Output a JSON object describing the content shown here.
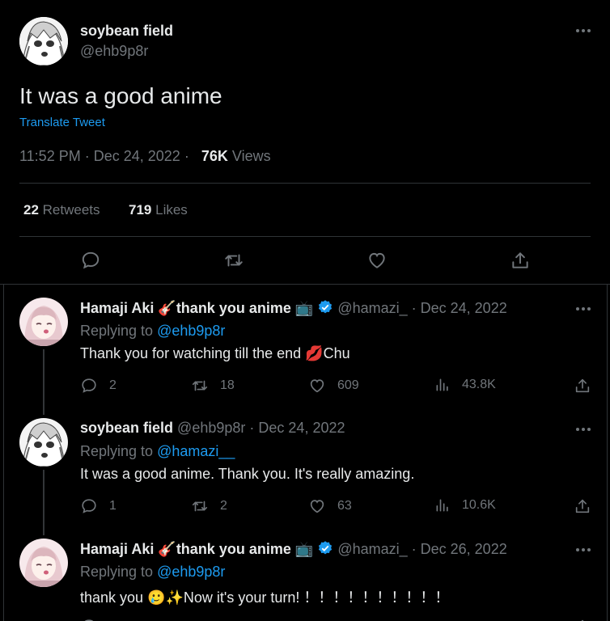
{
  "main_tweet": {
    "author_name": "soybean field",
    "author_handle": "@ehb9p8r",
    "text": "It was a good anime",
    "translate_label": "Translate Tweet",
    "time": "11:52 PM",
    "date": "Dec 24, 2022",
    "views_count": "76K",
    "views_label": "Views",
    "retweets_count": "22",
    "retweets_label": "Retweets",
    "likes_count": "719",
    "likes_label": "Likes"
  },
  "replies": [
    {
      "name": "Hamaji Aki",
      "name_suffix": "thank you anime",
      "verified": true,
      "handle": "@hamazi_",
      "date": "Dec 24, 2022",
      "replying_label": "Replying to",
      "replying_to": "@ehb9p8r",
      "text": "Thank you for watching till the end",
      "text_tail": "Chu",
      "emoji": [
        "lips"
      ],
      "replies": "2",
      "retweets": "18",
      "likes": "609",
      "views": "43.8K"
    },
    {
      "name": "soybean field",
      "verified": false,
      "handle": "@ehb9p8r",
      "date": "Dec 24, 2022",
      "replying_label": "Replying to",
      "replying_to": "@hamazi__",
      "text": "It was a good anime. Thank you. It's really amazing.",
      "replies": "1",
      "retweets": "2",
      "likes": "63",
      "views": "10.6K"
    },
    {
      "name": "Hamaji Aki",
      "name_suffix": "thank you anime",
      "verified": true,
      "handle": "@hamazi_",
      "date": "Dec 26, 2022",
      "replying_label": "Replying to",
      "replying_to": "@ehb9p8r",
      "text": "thank you",
      "text_tail": "Now it's your turn! ！！！！！！！！！！",
      "emoji": [
        "smiling-face-with-tear",
        "sparkles"
      ]
    }
  ],
  "colors": {
    "background": "#000000",
    "text": "#e7e9ea",
    "muted": "#71767b",
    "accent": "#1d9bf0",
    "border": "#2f3336"
  }
}
